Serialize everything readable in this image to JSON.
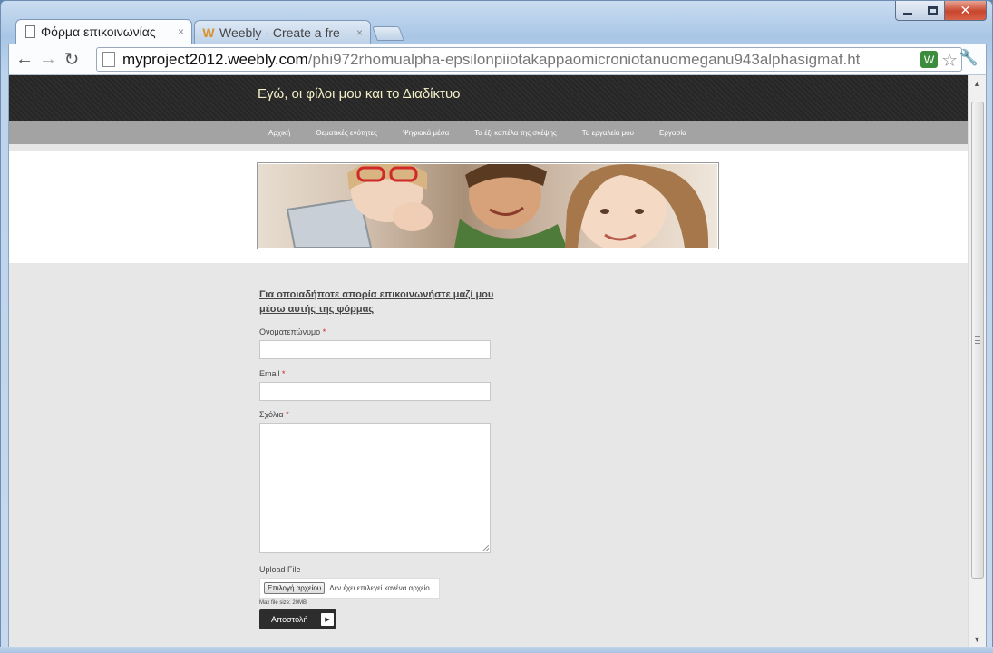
{
  "browser": {
    "tabs": [
      {
        "title": "Φόρμα επικοινωνίας",
        "favicon": "page-icon",
        "active": true
      },
      {
        "title": "Weebly - Create a fre",
        "favicon": "weebly-w-icon",
        "active": false
      }
    ],
    "close_glyph": "×",
    "address": {
      "host": "myproject2012.weebly.com",
      "path": "/phi972rhomualpha-epsilonpiiotakappaomicroniotanuomeganu943alphasigmaf.ht"
    },
    "glyphs": {
      "back": "←",
      "forward": "→",
      "reload": "↻",
      "star": "☆",
      "wrench": "🔧",
      "extension": "W",
      "close_window": "✕",
      "scroll_up": "▲",
      "scroll_down": "▼"
    }
  },
  "site": {
    "title": "Εγώ, οι φίλοι μου και το Διαδίκτυο",
    "nav": [
      "Αρχική",
      "Θεματικές ενότητες",
      "Ψηφιακά μέσα",
      "Τα έξι καπέλα της σκέψης",
      "Τα εργαλεία μου",
      "Εργασία"
    ]
  },
  "form": {
    "heading": "Για οποιαδήποτε απορία επικοινωνήστε μαζί μου μέσω αυτής της φόρμας",
    "required_mark": "*",
    "fields": [
      {
        "label": "Ονοματεπώνυμο",
        "value": ""
      },
      {
        "label": "Email",
        "value": ""
      },
      {
        "label": "Σχόλια",
        "value": ""
      }
    ],
    "upload": {
      "label": "Upload File",
      "button": "Επιλογή αρχείου",
      "status": "Δεν έχει επιλεγεί κανένα αρχείο",
      "max_size": "Max file size: 20MB"
    },
    "submit": "Αποστολή",
    "submit_arrow": "▶"
  },
  "colors": {
    "header_bg": "#2a2a2a",
    "nav_bg": "#a3a3a3",
    "title_color": "#f2efc7",
    "page_bg": "#e7e7e7"
  }
}
